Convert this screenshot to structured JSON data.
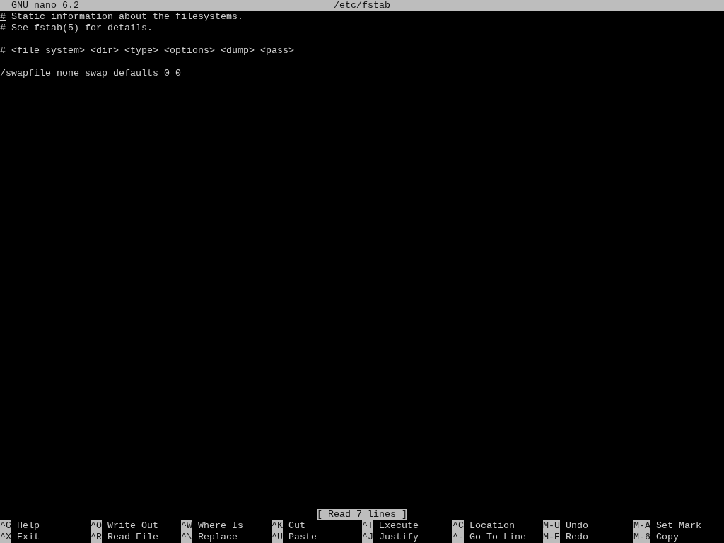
{
  "title_bar": {
    "app": "GNU nano 6.2",
    "file": "/etc/fstab"
  },
  "lines": [
    {
      "kind": "text",
      "text": "# Static information about the filesystems.",
      "cursor": true
    },
    {
      "kind": "text",
      "text": "# See fstab(5) for details.",
      "cursor": false
    },
    {
      "kind": "blank"
    },
    {
      "kind": "text",
      "text": "# <file system> <dir> <type> <options> <dump> <pass>",
      "cursor": false
    },
    {
      "kind": "blank"
    },
    {
      "kind": "text",
      "text": "/swapfile none swap defaults 0 0",
      "cursor": false
    }
  ],
  "status": "[ Read 7 lines ]",
  "shortcut_rows": [
    [
      {
        "key": "^G",
        "label": "Help"
      },
      {
        "key": "^O",
        "label": "Write Out"
      },
      {
        "key": "^W",
        "label": "Where Is"
      },
      {
        "key": "^K",
        "label": "Cut"
      },
      {
        "key": "^T",
        "label": "Execute"
      },
      {
        "key": "^C",
        "label": "Location"
      },
      {
        "key": "M-U",
        "label": "Undo"
      },
      {
        "key": "M-A",
        "label": "Set Mark"
      }
    ],
    [
      {
        "key": "^X",
        "label": "Exit"
      },
      {
        "key": "^R",
        "label": "Read File"
      },
      {
        "key": "^\\",
        "label": "Replace"
      },
      {
        "key": "^U",
        "label": "Paste"
      },
      {
        "key": "^J",
        "label": "Justify"
      },
      {
        "key": "^-",
        "label": "Go To Line"
      },
      {
        "key": "M-E",
        "label": "Redo"
      },
      {
        "key": "M-6",
        "label": "Copy"
      }
    ]
  ]
}
